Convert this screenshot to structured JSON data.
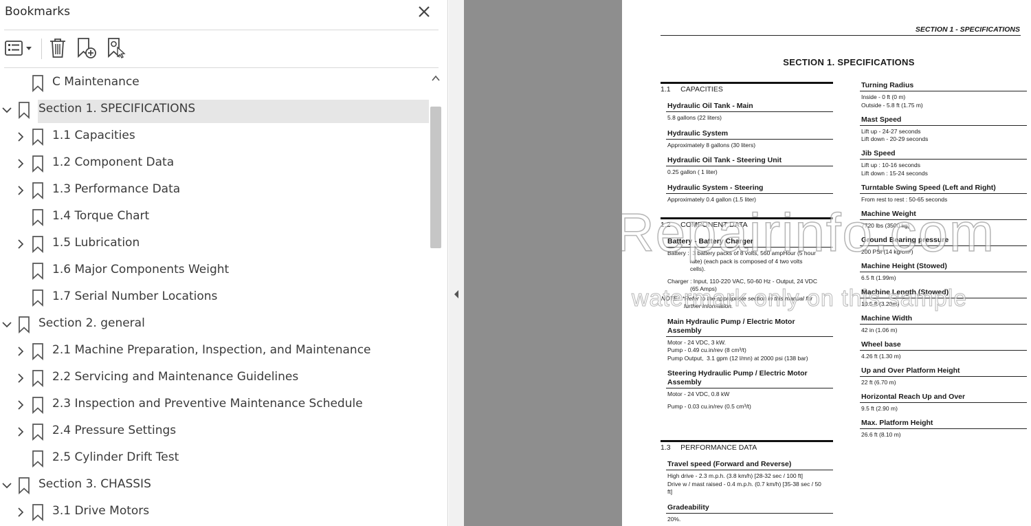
{
  "panel": {
    "title": "Bookmarks",
    "toolbar": [
      "options-menu",
      "delete-bookmark",
      "new-bookmark",
      "new-bookmark-from-structure"
    ]
  },
  "bookmarks": [
    {
      "label": "C Maintenance",
      "level": 1,
      "expander": "none",
      "selected": false
    },
    {
      "label": "Section 1. SPECIFICATIONS",
      "level": 0,
      "expander": "expanded",
      "selected": true
    },
    {
      "label": "1.1 Capacities",
      "level": 1,
      "expander": "collapsed",
      "selected": false
    },
    {
      "label": "1.2 Component Data",
      "level": 1,
      "expander": "collapsed",
      "selected": false
    },
    {
      "label": "1.3 Performance Data",
      "level": 1,
      "expander": "collapsed",
      "selected": false
    },
    {
      "label": "1.4 Torque Chart",
      "level": 1,
      "expander": "none",
      "selected": false
    },
    {
      "label": "1.5 Lubrication",
      "level": 1,
      "expander": "collapsed",
      "selected": false
    },
    {
      "label": "1.6 Major Components Weight",
      "level": 1,
      "expander": "none",
      "selected": false
    },
    {
      "label": "1.7 Serial Number Locations",
      "level": 1,
      "expander": "none",
      "selected": false
    },
    {
      "label": "Section 2. general",
      "level": 0,
      "expander": "expanded",
      "selected": false
    },
    {
      "label": "2.1 Machine Preparation, Inspection, and Maintenance",
      "level": 1,
      "expander": "collapsed",
      "selected": false
    },
    {
      "label": "2.2 Servicing and Maintenance Guidelines",
      "level": 1,
      "expander": "collapsed",
      "selected": false
    },
    {
      "label": "2.3 Inspection and Preventive Maintenance Schedule",
      "level": 1,
      "expander": "collapsed",
      "selected": false
    },
    {
      "label": "2.4 Pressure Settings",
      "level": 1,
      "expander": "collapsed",
      "selected": false
    },
    {
      "label": "2.5 Cylinder Drift Test",
      "level": 1,
      "expander": "none",
      "selected": false
    },
    {
      "label": "Section 3. CHASSIS",
      "level": 0,
      "expander": "expanded",
      "selected": false
    },
    {
      "label": "3.1 Drive Motors",
      "level": 1,
      "expander": "collapsed",
      "selected": false
    }
  ],
  "document": {
    "running_head": "SECTION 1 - SPECIFICATIONS",
    "section_title": "SECTION 1.  SPECIFICATIONS",
    "watermark": [
      "eRepairinfo.com",
      "watermark only on this sample"
    ],
    "left_sections": [
      {
        "number": "1.1",
        "title": "CAPACITIES",
        "items": [
          {
            "title": "Hydraulic Oil Tank - Main",
            "lines": [
              "5.8 gallons (22 liters)"
            ]
          },
          {
            "title": "Hydraulic System",
            "lines": [
              "Approximately 8 gallons (30 liters)"
            ]
          },
          {
            "title": "Hydraulic Oil Tank - Steering Unit",
            "lines": [
              "0.25 gallon ( 1 liter)"
            ]
          },
          {
            "title": "Hydraulic System - Steering",
            "lines": [
              "Approximately 0.4 gallon (1.5 liter)"
            ]
          }
        ]
      },
      {
        "number": "1.2",
        "title": "COMPONENT DATA",
        "items": [
          {
            "title": "Battery - Battery Charger",
            "lines": [
              "Battery :  3 battery packs of 8 volts, 560 ampHour (5 hour",
              "              rate) (each pack is composed of 4 two volts",
              "              cells).",
              "",
              "Charger : Input, 110-220 VAC, 50-60 Hz - Output, 24 VDC",
              "              (65 Amps)"
            ],
            "note": [
              "NOTE:  *Refer to the appropriate section in this manual for",
              "              further information."
            ]
          },
          {
            "title": "Main Hydraulic Pump / Electric Motor\nAssembly",
            "lines": [
              "Motor - 24 VDC, 3 kW.",
              "Pump - 0.49 cu.in/rev (8 cm³/t)",
              "Pump Output,  3.1 gpm (12 l/mn) at 2000 psi (138 bar)"
            ]
          },
          {
            "title": "Steering Hydraulic Pump / Electric Motor\nAssembly",
            "lines": [
              "Motor - 24 VDC, 0.8 kW",
              "",
              "Pump - 0.03 cu.in/rev (0.5 cm³/t)"
            ]
          }
        ]
      },
      {
        "number": "1.3",
        "title": "PERFORMANCE DATA",
        "items": [
          {
            "title": "Travel speed (Forward and Reverse)",
            "lines": [
              "High drive - 2.3 m.p.h. (3.8 km/h) [28-32 sec / 100 ft]",
              "Drive w / mast raised - 0.4 m.p.h. (0.7 km/h) [35-38 sec / 50",
              "ft]"
            ]
          },
          {
            "title": "Gradeability",
            "lines": [
              "20%."
            ]
          }
        ]
      }
    ],
    "right_items": [
      {
        "title": "Turning Radius",
        "lines": [
          "Inside - 0 ft (0 m)",
          "Outside - 5.8 ft (1.75 m)"
        ]
      },
      {
        "title": "Mast Speed",
        "lines": [
          "Lift up - 24-27 seconds",
          "Lift down - 20-29 seconds"
        ]
      },
      {
        "title": "Jib Speed",
        "lines": [
          "Lift up : 10-16 seconds",
          "Lift down : 15-24 seconds"
        ]
      },
      {
        "title": "Turntable Swing Speed (Left and Right)",
        "lines": [
          "From rest to rest : 50-65 seconds"
        ]
      },
      {
        "title": "Machine Weight",
        "lines": [
          "7720 lbs (3500 kg)"
        ]
      },
      {
        "title": "Ground Bearing pressure",
        "lines": [
          "200 PSI (14 kg/cm²)"
        ]
      },
      {
        "title": "Machine Height (Stowed)",
        "lines": [
          "6.5 ft (1.99m)"
        ]
      },
      {
        "title": "Machine Length (Stowed)",
        "lines": [
          "10.5 ft (3.20m)"
        ]
      },
      {
        "title": "Machine Width",
        "lines": [
          "42 in (1.06 m)"
        ]
      },
      {
        "title": "Wheel base",
        "lines": [
          "4.26 ft (1.30 m)"
        ]
      },
      {
        "title": "Up and Over Platform Height",
        "lines": [
          "22 ft (6.70 m)"
        ]
      },
      {
        "title": "Horizontal Reach Up and Over",
        "lines": [
          "9.5 ft (2.90 m)"
        ]
      },
      {
        "title": "Max. Platform Height",
        "lines": [
          "26.6 ft (8.10 m)"
        ]
      }
    ]
  }
}
